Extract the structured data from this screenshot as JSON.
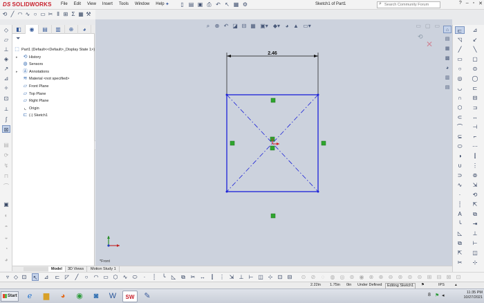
{
  "app": {
    "brand": "SOLIDWORKS",
    "brand_prefix": "DS",
    "document_title": "Sketch1 of Part1",
    "search_placeholder": "Search Community Forum",
    "menu": [
      "File",
      "Edit",
      "View",
      "Insert",
      "Tools",
      "Window",
      "Help"
    ]
  },
  "feature_tree": {
    "root": "Part1  (Default<<Default>_Display State 1>)",
    "items": [
      {
        "label": "History",
        "icon": "history-icon",
        "expandable": true
      },
      {
        "label": "Sensors",
        "icon": "sensor-icon",
        "expandable": false
      },
      {
        "label": "Annotations",
        "icon": "annotation-icon",
        "expandable": true
      },
      {
        "label": "Material <not specified>",
        "icon": "material-icon",
        "expandable": false
      },
      {
        "label": "Front Plane",
        "icon": "plane-icon",
        "expandable": false
      },
      {
        "label": "Top Plane",
        "icon": "plane-icon",
        "expandable": false
      },
      {
        "label": "Right Plane",
        "icon": "plane-icon",
        "expandable": false
      },
      {
        "label": "Origin",
        "icon": "origin-icon",
        "expandable": false
      },
      {
        "label": "(-) Sketch1",
        "icon": "sketch-icon",
        "expandable": false
      }
    ]
  },
  "viewport": {
    "dimension_label": "2.46",
    "view_name": "*Front",
    "sketch_color": "#1a20d8",
    "relation_color": "#2ea52e",
    "background": "#ccd2dd"
  },
  "bottom_tabs": [
    "Model",
    "3D Views",
    "Motion Study 1"
  ],
  "status": {
    "x": "2.22in",
    "y": "1.75in",
    "z": "0in",
    "state": "Under Defined",
    "editing": "Editing Sketch1",
    "units": "IPS"
  },
  "taskbar": {
    "start_label": "Start",
    "time": "11:35 PM",
    "date": "10/27/2021"
  }
}
